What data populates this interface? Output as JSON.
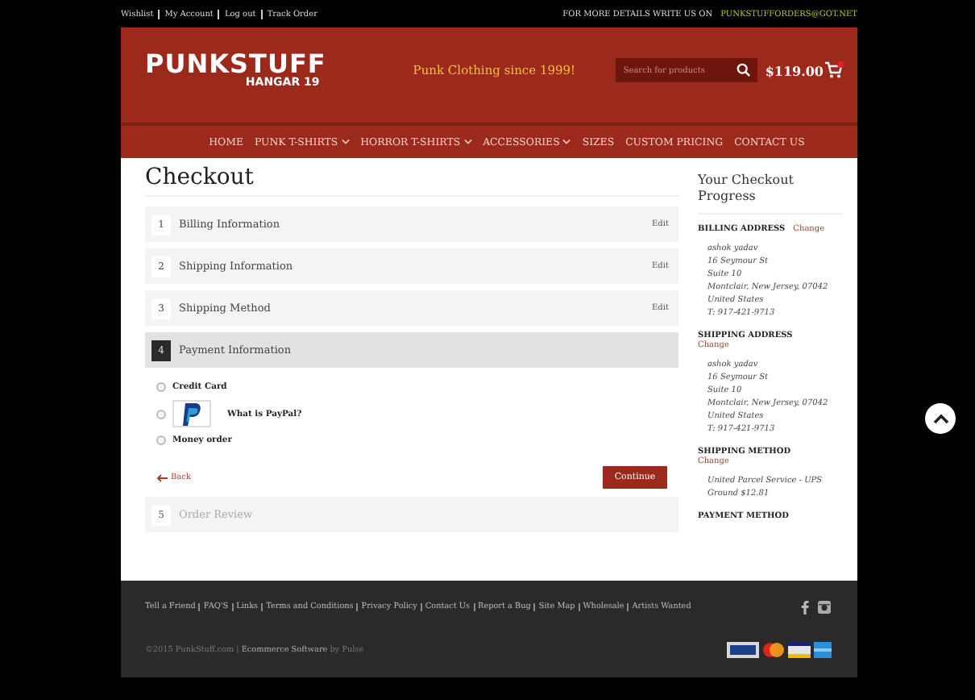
{
  "top_bar": {
    "links": [
      "Wishlist",
      "My Account",
      "Log out",
      "Track Order"
    ],
    "contact_label": "FOR MORE DETAILS WRITE US ON",
    "contact_email": "PUNKSTUFFORDERS@GOT.NET"
  },
  "header": {
    "logo_title": "PUNKSTUFF",
    "logo_subtitle": "HANGAR 19",
    "tagline": "Punk Clothing since 1999!",
    "search": {
      "placeholder": "Search for products"
    },
    "cart_total": "$119.00"
  },
  "nav": [
    {
      "label": "HOME",
      "dropdown": false
    },
    {
      "label": "PUNK T-SHIRTS",
      "dropdown": true
    },
    {
      "label": "HORROR T-SHIRTS",
      "dropdown": true
    },
    {
      "label": "ACCESSORIES",
      "dropdown": true
    },
    {
      "label": "SIZES",
      "dropdown": false
    },
    {
      "label": "CUSTOM PRICING",
      "dropdown": false
    },
    {
      "label": "CONTACT US",
      "dropdown": false
    }
  ],
  "page_title": "Checkout",
  "steps": [
    {
      "number": "1",
      "title": "Billing Information",
      "selected": false,
      "disabled": false,
      "action": "Edit"
    },
    {
      "number": "2",
      "title": "Shipping Information",
      "selected": false,
      "disabled": false,
      "action": "Edit"
    },
    {
      "number": "3",
      "title": "Shipping Method",
      "selected": false,
      "disabled": false,
      "action": "Edit"
    },
    {
      "number": "4",
      "title": "Payment Information",
      "selected": true,
      "disabled": false
    },
    {
      "number": "5",
      "title": "Order Review",
      "selected": false,
      "disabled": true
    }
  ],
  "payment_options": [
    {
      "kind": "text",
      "label": "Credit Card",
      "selected": false
    },
    {
      "kind": "paypal",
      "label": "What is PayPal?",
      "selected": false
    },
    {
      "kind": "text",
      "label": "Money order",
      "selected": false
    }
  ],
  "back_link": "Back",
  "continue_button": "Continue",
  "progress": {
    "title": "Your Checkout Progress",
    "sections": [
      {
        "heading": "BILLING ADDRESS",
        "change": "Change",
        "lines": [
          "ashok yadav",
          "16 Seymour St",
          "Suite 10",
          "Montclair, New Jersey, 07042",
          "United States",
          "T: 917-421-9713"
        ]
      },
      {
        "heading": "SHIPPING ADDRESS",
        "change": "Change",
        "lines": [
          "ashok yadav",
          "16 Seymour St",
          "Suite 10",
          "Montclair, New Jersey, 07042",
          "United States",
          "T: 917-421-9713"
        ]
      },
      {
        "heading": "SHIPPING METHOD",
        "change": "Change",
        "lines": [
          "United Parcel Service - UPS Ground $12.81"
        ]
      },
      {
        "heading": "PAYMENT METHOD"
      }
    ]
  },
  "footer": {
    "links": [
      "Tell a Friend",
      "FAQ'S",
      "Links",
      "Terms and Conditions",
      "Privacy Policy",
      "Contact Us",
      "Report a Bug",
      "Site Map",
      "Wholesale",
      "Artists Wanted"
    ],
    "copyright": "©2015 PunkStuff.com | **Ecommerce Software** by Pulse"
  }
}
